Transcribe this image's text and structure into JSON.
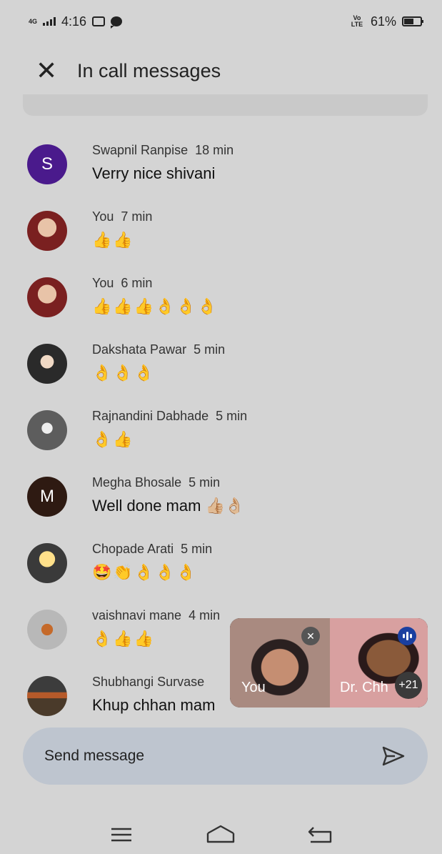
{
  "status_bar": {
    "network": "4G",
    "time": "4:16",
    "volte": "Vo LTE",
    "battery": "61%"
  },
  "header": {
    "title": "In call messages"
  },
  "messages": [
    {
      "sender": "Swapnil Ranpise",
      "time": "18 min",
      "text": "Verry nice shivani",
      "avatar_letter": "S"
    },
    {
      "sender": "You",
      "time": "7 min",
      "text": "👍👍"
    },
    {
      "sender": "You",
      "time": "6 min",
      "text": "👍👍👍👌👌👌"
    },
    {
      "sender": "Dakshata Pawar",
      "time": "5 min",
      "text": "👌👌👌"
    },
    {
      "sender": "Rajnandini Dabhade",
      "time": "5 min",
      "text": "👌👍"
    },
    {
      "sender": "Megha Bhosale",
      "time": "5 min",
      "text": "Well done mam 👍🏼👌🏼",
      "avatar_letter": "M"
    },
    {
      "sender": "Chopade Arati",
      "time": "5 min",
      "text": "🤩👏👌👌👌"
    },
    {
      "sender": "vaishnavi mane",
      "time": "4 min",
      "text": "👌👍👍"
    },
    {
      "sender": "Shubhangi Survase",
      "time": "",
      "text": "Khup chhan mam"
    }
  ],
  "pip": {
    "self_label": "You",
    "remote_label": "Dr. Chh",
    "more_count": "+21"
  },
  "composer": {
    "placeholder": "Send message"
  },
  "colors": {
    "avatar_purple": "#4a1a8c",
    "avatar_brown": "#2e1a12",
    "speaking_blue": "#1a3fa0"
  }
}
